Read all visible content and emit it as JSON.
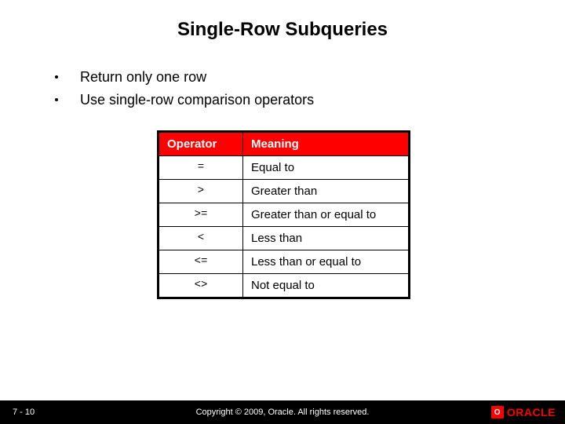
{
  "title": "Single-Row Subqueries",
  "bullets": [
    "Return only one row",
    "Use single-row comparison operators"
  ],
  "table": {
    "headers": {
      "op": "Operator",
      "meaning": "Meaning"
    },
    "rows": [
      {
        "op": "=",
        "meaning": "Equal to"
      },
      {
        "op": ">",
        "meaning": "Greater than"
      },
      {
        "op": ">=",
        "meaning": "Greater than or equal to"
      },
      {
        "op": "<",
        "meaning": "Less than"
      },
      {
        "op": "<=",
        "meaning": "Less than or equal to"
      },
      {
        "op": "<>",
        "meaning": "Not equal to"
      }
    ]
  },
  "footer": {
    "page": "7 - 10",
    "copyright": "Copyright © 2009, Oracle. All rights reserved.",
    "brand": "ORACLE",
    "brand_mark": "O"
  }
}
